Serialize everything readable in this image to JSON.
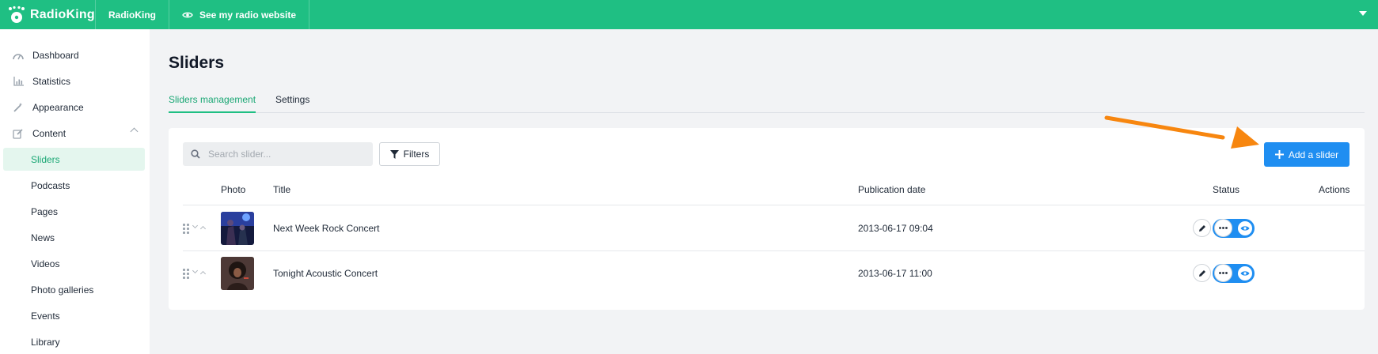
{
  "topbar": {
    "brand": "RadioKing",
    "account": "RadioKing",
    "website_link": "See my radio website"
  },
  "sidebar": {
    "items": [
      {
        "label": "Dashboard",
        "icon": "dashboard-icon"
      },
      {
        "label": "Statistics",
        "icon": "chart-icon"
      },
      {
        "label": "Appearance",
        "icon": "magic-wand-icon"
      },
      {
        "label": "Content",
        "icon": "edit-icon"
      },
      {
        "label": "Sliders",
        "active": true
      },
      {
        "label": "Podcasts"
      },
      {
        "label": "Pages"
      },
      {
        "label": "News"
      },
      {
        "label": "Videos"
      },
      {
        "label": "Photo galleries"
      },
      {
        "label": "Events"
      },
      {
        "label": "Library"
      }
    ]
  },
  "page": {
    "title": "Sliders",
    "tabs": [
      {
        "label": "Sliders management",
        "active": true
      },
      {
        "label": "Settings",
        "active": false
      }
    ]
  },
  "toolbar": {
    "search_placeholder": "Search slider...",
    "filters_label": "Filters",
    "add_label": "Add a slider"
  },
  "table": {
    "columns": [
      "Photo",
      "Title",
      "Publication date",
      "Status",
      "Actions"
    ],
    "rows": [
      {
        "title": "Next Week Rock Concert",
        "date": "2013-06-17 09:04",
        "status_visible": true
      },
      {
        "title": "Tonight Acoustic Concert",
        "date": "2013-06-17 11:00",
        "status_visible": true
      }
    ]
  },
  "colors": {
    "brand_green": "#1fbf83",
    "primary_blue": "#1f8ef1",
    "annotation_arrow": "#f7860f"
  }
}
